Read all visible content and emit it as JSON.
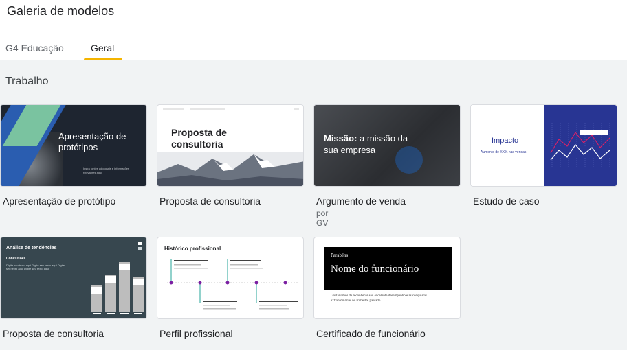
{
  "header": {
    "title": "Galeria de modelos",
    "tabs": [
      {
        "label": "G4 Educação"
      },
      {
        "label": "Geral"
      }
    ],
    "active_tab": "Geral"
  },
  "section": {
    "title": "Trabalho"
  },
  "templates": [
    {
      "name": "Apresentação de protótipo",
      "thumb_text": {
        "title": "Apresentação de protótipos",
        "body": "Insira fontes adicionais e informações relevantes aqui"
      }
    },
    {
      "name": "Proposta de consultoria",
      "thumb_text": {
        "title": "Proposta de consultoria",
        "body": "Digite seu texto aqui"
      }
    },
    {
      "name": "Argumento de venda",
      "author": "por GV",
      "thumb_text": {
        "title_bold": "Missão:",
        "title_rest": "a missão da sua empresa"
      }
    },
    {
      "name": "Estudo de caso",
      "thumb_text": {
        "title": "Impacto",
        "body": "Aumento de XX% nas vendas"
      }
    },
    {
      "name": "Proposta de consultoria",
      "thumb_text": {
        "title": "Análise de tendências",
        "subtitle": "Conclusões",
        "body": "Digite seu texto aqui Digite seu texto aqui Digite seu texto aqui Digite seu texto aqui"
      }
    },
    {
      "name": "Perfil profissional",
      "thumb_text": {
        "title": "Histórico profissional"
      }
    },
    {
      "name": "Certificado de funcionário",
      "thumb_text": {
        "label": "Parabéns!",
        "title": "Nome do funcionário",
        "body": "Gostaríamos de reconhecer seu excelente desempenho e as conquistas extraordinárias no trimestre passado"
      }
    }
  ],
  "colors": {
    "accent_underline": "#f4b400",
    "background": "#f1f3f4",
    "header_bg": "#ffffff"
  }
}
